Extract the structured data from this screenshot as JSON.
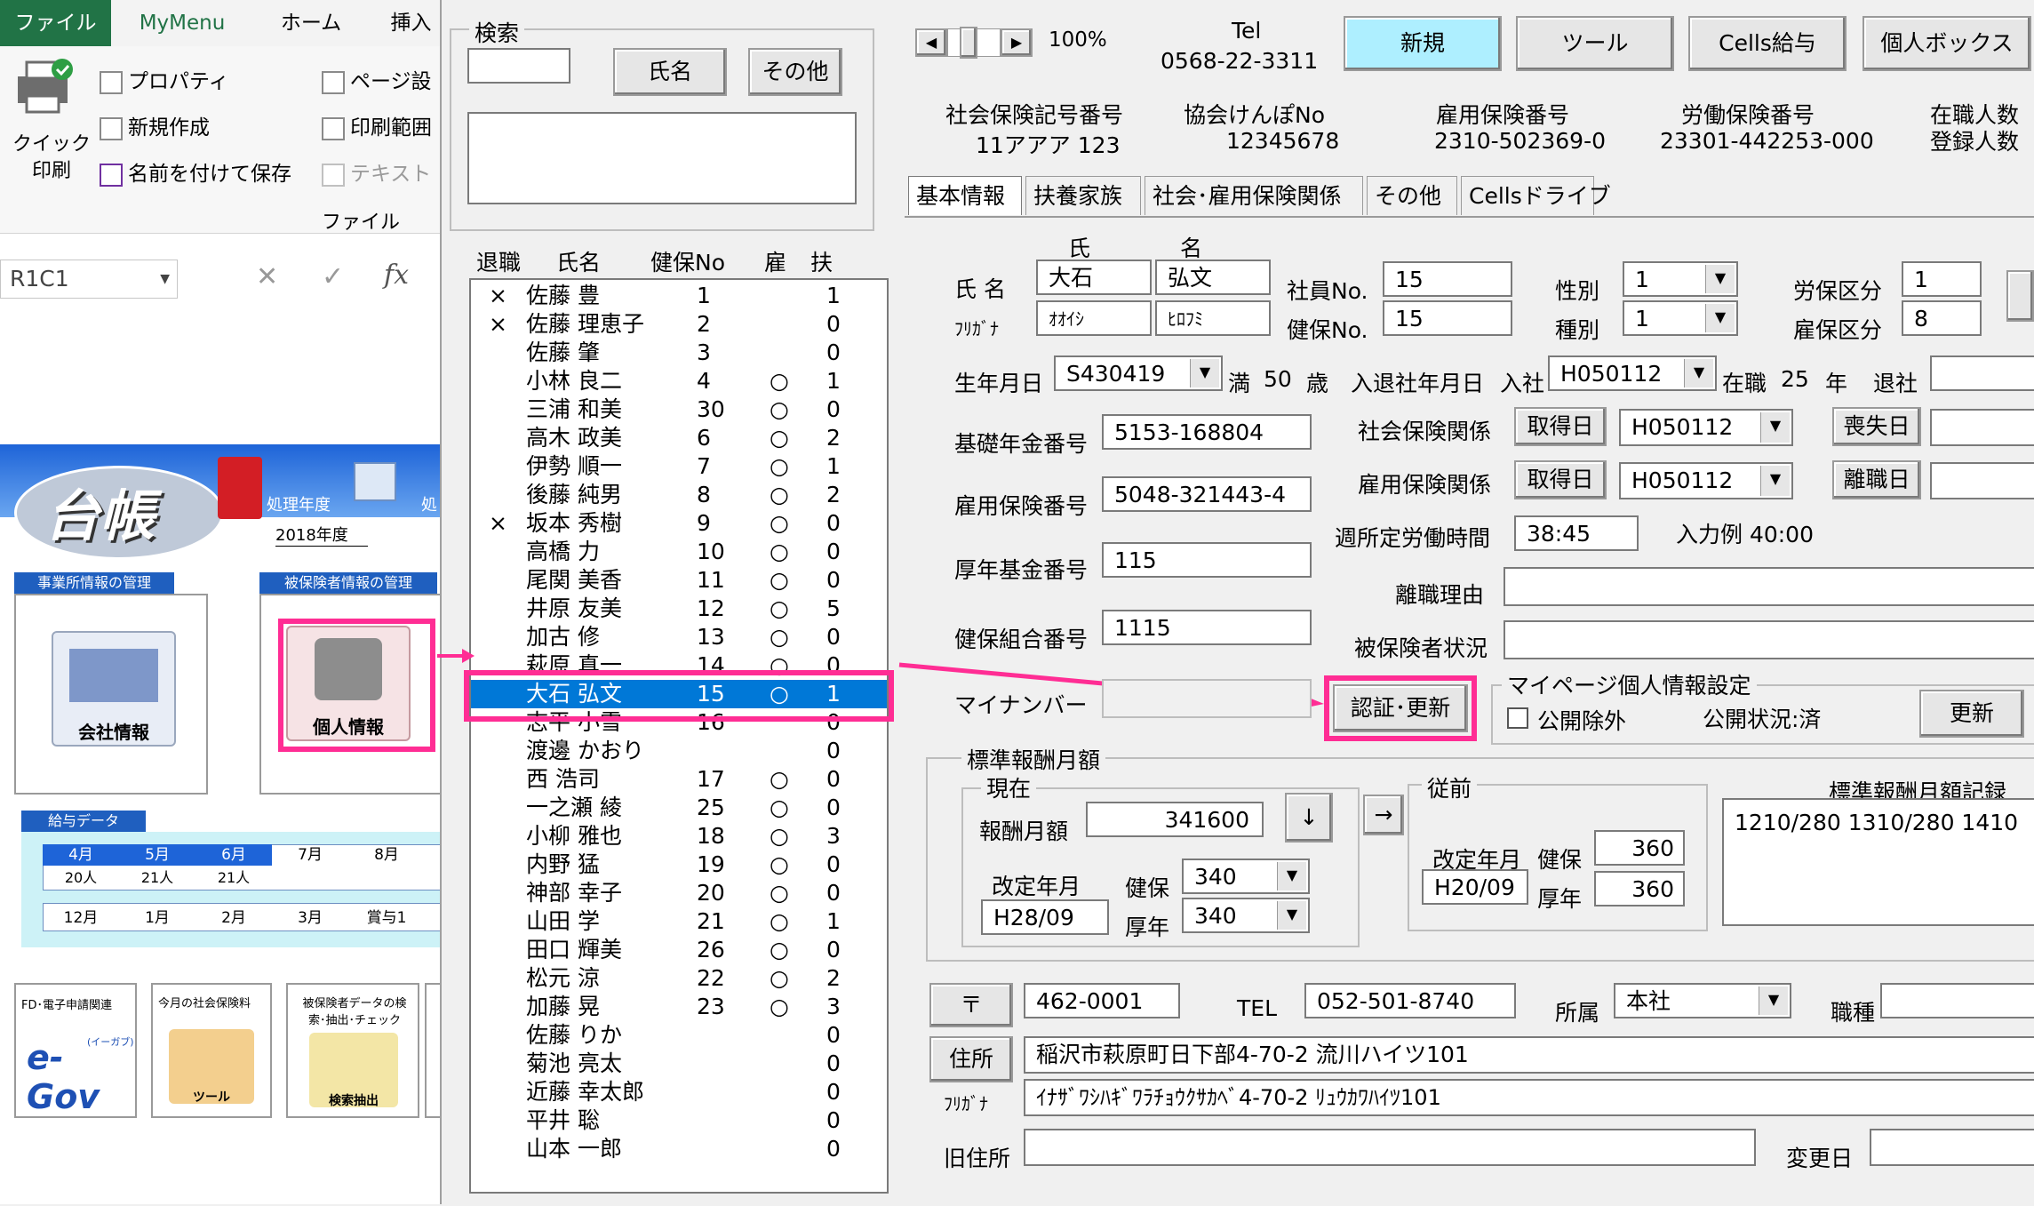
{
  "excel": {
    "tabs": [
      "ファイル",
      "MyMenu",
      "ホーム",
      "挿入"
    ],
    "quick_print": "クイック\n印刷",
    "properties": "プロパティ",
    "new_create": "新規作成",
    "save_as": "名前を付けて保存",
    "page_setup": "ページ設",
    "print_range": "印刷範囲",
    "text": "テキスト",
    "file_group": "ファイル",
    "namebox": "R1C1",
    "fx": "fx"
  },
  "daicho": {
    "title": "台帳",
    "year_label": "処理年度",
    "year_label2": "処",
    "year_value": "2018年度",
    "office_panel": "事業所情報の管理",
    "insured_panel": "被保険者情報の管理",
    "company_info": "会社情報",
    "personal_info": "個人情報",
    "salary_data": "給与データ",
    "months_row1": [
      "4月",
      "5月",
      "6月",
      "7月",
      "8月"
    ],
    "counts_row1": [
      "20人",
      "21人",
      "21人",
      "",
      ""
    ],
    "months_row2": [
      "12月",
      "1月",
      "2月",
      "3月",
      "賞与1"
    ],
    "tile_egov_top": "FD･電子申請関連",
    "tile_egov": "e-Gov",
    "tile_egov_small": "(イーガブ)",
    "tile_tool_top": "今月の社会保険料",
    "tile_tool": "ツール",
    "tile_search_top": "被保険者データの検索･抽出･チェック",
    "tile_search": "検索抽出"
  },
  "search": {
    "legend": "検索",
    "name_btn": "氏名",
    "other_btn": "その他"
  },
  "list": {
    "headers": [
      "退職",
      "氏名",
      "健保No",
      "雇",
      "扶"
    ],
    "rows": [
      {
        "ret": "×",
        "name": "佐藤 豊",
        "no": "1",
        "koyo": "",
        "fu": "1"
      },
      {
        "ret": "×",
        "name": "佐藤 理恵子",
        "no": "2",
        "koyo": "",
        "fu": "0"
      },
      {
        "ret": "",
        "name": "佐藤 肇",
        "no": "3",
        "koyo": "",
        "fu": "0"
      },
      {
        "ret": "",
        "name": "小林 良二",
        "no": "4",
        "koyo": "○",
        "fu": "1"
      },
      {
        "ret": "",
        "name": "三浦 和美",
        "no": "30",
        "koyo": "○",
        "fu": "0"
      },
      {
        "ret": "",
        "name": "高木 政美",
        "no": "6",
        "koyo": "○",
        "fu": "2"
      },
      {
        "ret": "",
        "name": "伊勢 順一",
        "no": "7",
        "koyo": "○",
        "fu": "1"
      },
      {
        "ret": "",
        "name": "後藤 純男",
        "no": "8",
        "koyo": "○",
        "fu": "2"
      },
      {
        "ret": "×",
        "name": "坂本 秀樹",
        "no": "9",
        "koyo": "○",
        "fu": "0"
      },
      {
        "ret": "",
        "name": "高橋 力",
        "no": "10",
        "koyo": "○",
        "fu": "0"
      },
      {
        "ret": "",
        "name": "尾関 美香",
        "no": "11",
        "koyo": "○",
        "fu": "0"
      },
      {
        "ret": "",
        "name": "井原 友美",
        "no": "12",
        "koyo": "○",
        "fu": "5"
      },
      {
        "ret": "",
        "name": "加古 修",
        "no": "13",
        "koyo": "○",
        "fu": "0"
      },
      {
        "ret": "",
        "name": "萩原 真一",
        "no": "14",
        "koyo": "○",
        "fu": "0"
      },
      {
        "ret": "",
        "name": "大石 弘文",
        "no": "15",
        "koyo": "○",
        "fu": "1"
      },
      {
        "ret": "",
        "name": "志平 小雪",
        "no": "16",
        "koyo": "",
        "fu": "0"
      },
      {
        "ret": "",
        "name": "渡邊 かおり",
        "no": "",
        "koyo": "",
        "fu": "0"
      },
      {
        "ret": "",
        "name": "西 浩司",
        "no": "17",
        "koyo": "○",
        "fu": "0"
      },
      {
        "ret": "",
        "name": "一之瀬 綾",
        "no": "25",
        "koyo": "○",
        "fu": "0"
      },
      {
        "ret": "",
        "name": "小柳 雅也",
        "no": "18",
        "koyo": "○",
        "fu": "3"
      },
      {
        "ret": "",
        "name": "内野 猛",
        "no": "19",
        "koyo": "○",
        "fu": "0"
      },
      {
        "ret": "",
        "name": "神部 幸子",
        "no": "20",
        "koyo": "○",
        "fu": "0"
      },
      {
        "ret": "",
        "name": "山田 学",
        "no": "21",
        "koyo": "○",
        "fu": "1"
      },
      {
        "ret": "",
        "name": "田口 輝美",
        "no": "26",
        "koyo": "○",
        "fu": "0"
      },
      {
        "ret": "",
        "name": "松元 涼",
        "no": "22",
        "koyo": "○",
        "fu": "2"
      },
      {
        "ret": "",
        "name": "加藤 晃",
        "no": "23",
        "koyo": "○",
        "fu": "3"
      },
      {
        "ret": "",
        "name": "佐藤 りか",
        "no": "",
        "koyo": "",
        "fu": "0"
      },
      {
        "ret": "",
        "name": "菊池 亮太",
        "no": "",
        "koyo": "",
        "fu": "0"
      },
      {
        "ret": "",
        "name": "近藤 幸太郎",
        "no": "",
        "koyo": "",
        "fu": "0"
      },
      {
        "ret": "",
        "name": "平井 聡",
        "no": "",
        "koyo": "",
        "fu": "0"
      },
      {
        "ret": "",
        "name": "山本 一郎",
        "no": "",
        "koyo": "",
        "fu": "0"
      }
    ],
    "selected_index": 14
  },
  "top": {
    "zoom": "100%",
    "tel_label": "Tel",
    "tel_value": "0568-22-3311",
    "btn_new": "新規",
    "btn_tool": "ツール",
    "btn_cells": "Cells給与",
    "btn_personal_box": "個人ボックス",
    "shaho_label": "社会保険記号番号",
    "shaho_value": "11アアア 123",
    "kyokai_label": "協会けんぽNo",
    "kyokai_value": "12345678",
    "koyo_label": "雇用保険番号",
    "koyo_value": "2310-502369-0",
    "rodo_label": "労働保険番号",
    "rodo_value": "23301-442253-000",
    "zaishoku_label": "在職人数",
    "toroku_label": "登録人数"
  },
  "tabs": [
    "基本情報",
    "扶養家族",
    "社会･雇用保険関係",
    "その他",
    "Cellsドライブ"
  ],
  "basic": {
    "col_sei": "氏",
    "col_mei": "名",
    "name_label": "氏 名",
    "kana_label": "ﾌﾘｶﾞﾅ",
    "sei": "大石",
    "mei": "弘文",
    "sei_kana": "ｵｵｲｼ",
    "mei_kana": "ﾋﾛﾌﾐ",
    "emp_no_label": "社員No.",
    "emp_no": "15",
    "kenpo_no_label": "健保No.",
    "kenpo_no": "15",
    "gender_label": "性別",
    "gender": "1",
    "type_label": "種別",
    "type": "1",
    "rouho_label": "労保区分",
    "rouho": "1",
    "koho_label": "雇保区分",
    "koho": "8",
    "birth_label": "生年月日",
    "birth": "S430419",
    "age_prefix": "満",
    "age": "50",
    "age_suffix": "歳",
    "join_leave_label": "入退社年月日",
    "join_label": "入社",
    "join_date": "H050112",
    "tenure_prefix": "在職",
    "tenure": "25",
    "tenure_suffix": "年",
    "leave_label": "退社",
    "pension_label": "基礎年金番号",
    "pension": "5153-168804",
    "emp_ins_label": "雇用保険番号",
    "emp_ins": "5048-321443-4",
    "welfare_label": "厚年基金番号",
    "welfare": "115",
    "union_label": "健保組合番号",
    "union": "1115",
    "mynumber_label": "マイナンバー",
    "social_label": "社会保険関係",
    "acquire_btn": "取得日",
    "social_date": "H050112",
    "lose_btn": "喪失日",
    "empins_rel_label": "雇用保険関係",
    "acquire_btn2": "取得日",
    "empins_date": "H050112",
    "leave_btn": "離職日",
    "work_hours_label": "週所定労働時間",
    "work_hours": "38:45",
    "input_example": "入力例 40:00",
    "leave_reason_label": "離職理由",
    "insured_status_label": "被保険者状況",
    "auth_btn": "認証･更新",
    "mypage_legend": "マイページ個人情報設定",
    "public_exclude": "公開除外",
    "public_status": "公開状況:済",
    "update_btn": "更新"
  },
  "salary": {
    "legend": "標準報酬月額",
    "current_legend": "現在",
    "monthly_label": "報酬月額",
    "monthly": "341600",
    "arrow_down": "↓",
    "arrow_right": "→",
    "revision_label": "改定年月",
    "revision": "H28/09",
    "kenpo_label": "健保",
    "kenpo": "340",
    "kounen_label": "厚年",
    "kounen": "340",
    "prev_legend": "従前",
    "prev_revision_label": "改定年月",
    "prev_revision": "H20/09",
    "prev_kenpo_label": "健保",
    "prev_kenpo": "360",
    "prev_kounen_label": "厚年",
    "prev_kounen": "360",
    "record_label": "標準報酬月額記録",
    "record": "1210/280 1310/280 1410"
  },
  "address": {
    "zip_btn": "〒",
    "zip": "462-0001",
    "tel_label": "TEL",
    "tel": "052-501-8740",
    "dept_label": "所属",
    "dept": "本社",
    "job_label": "職種",
    "addr_btn": "住所",
    "address": "稲沢市萩原町日下部4-70-2 流川ハイツ101",
    "kana_label": "ﾌﾘｶﾞﾅ",
    "address_kana": "ｲﾅｻﾞﾜｼﾊｷﾞﾜﾗﾁｮｳｸｻｶﾍﾞ4-70-2 ﾘｭｳｶﾜﾊｲﾂ101",
    "old_addr_label": "旧住所",
    "change_date_label": "変更日"
  },
  "colors": {
    "highlight": "#ff2d94",
    "selected": "#0078d7",
    "new_btn": "#aeefff",
    "ribbon_file": "#217346"
  }
}
